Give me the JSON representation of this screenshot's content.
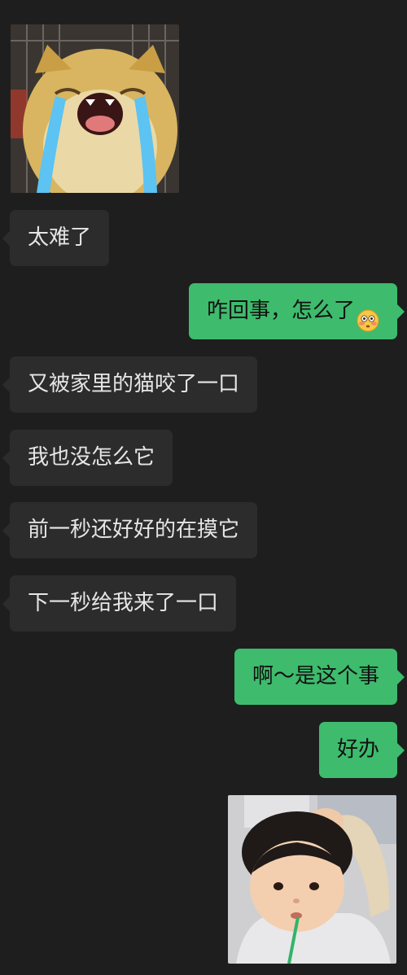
{
  "colors": {
    "background": "#1e1e1e",
    "incoming_bubble": "#2c2c2c",
    "outgoing_bubble": "#3ebb6d"
  },
  "stickers": {
    "top": {
      "sender": "other",
      "icon": "crying-cat-sticker"
    },
    "bottom": {
      "sender": "me",
      "icon": "toddler-photo-sticker"
    }
  },
  "messages": [
    {
      "sender": "other",
      "text": "太难了"
    },
    {
      "sender": "me",
      "text": "咋回事，怎么了",
      "emoji": "flushed-face-emoji"
    },
    {
      "sender": "other",
      "text": "又被家里的猫咬了一口"
    },
    {
      "sender": "other",
      "text": "我也没怎么它"
    },
    {
      "sender": "other",
      "text": "前一秒还好好的在摸它"
    },
    {
      "sender": "other",
      "text": "下一秒给我来了一口"
    },
    {
      "sender": "me",
      "text": "啊～是这个事"
    },
    {
      "sender": "me",
      "text": "好办"
    }
  ]
}
